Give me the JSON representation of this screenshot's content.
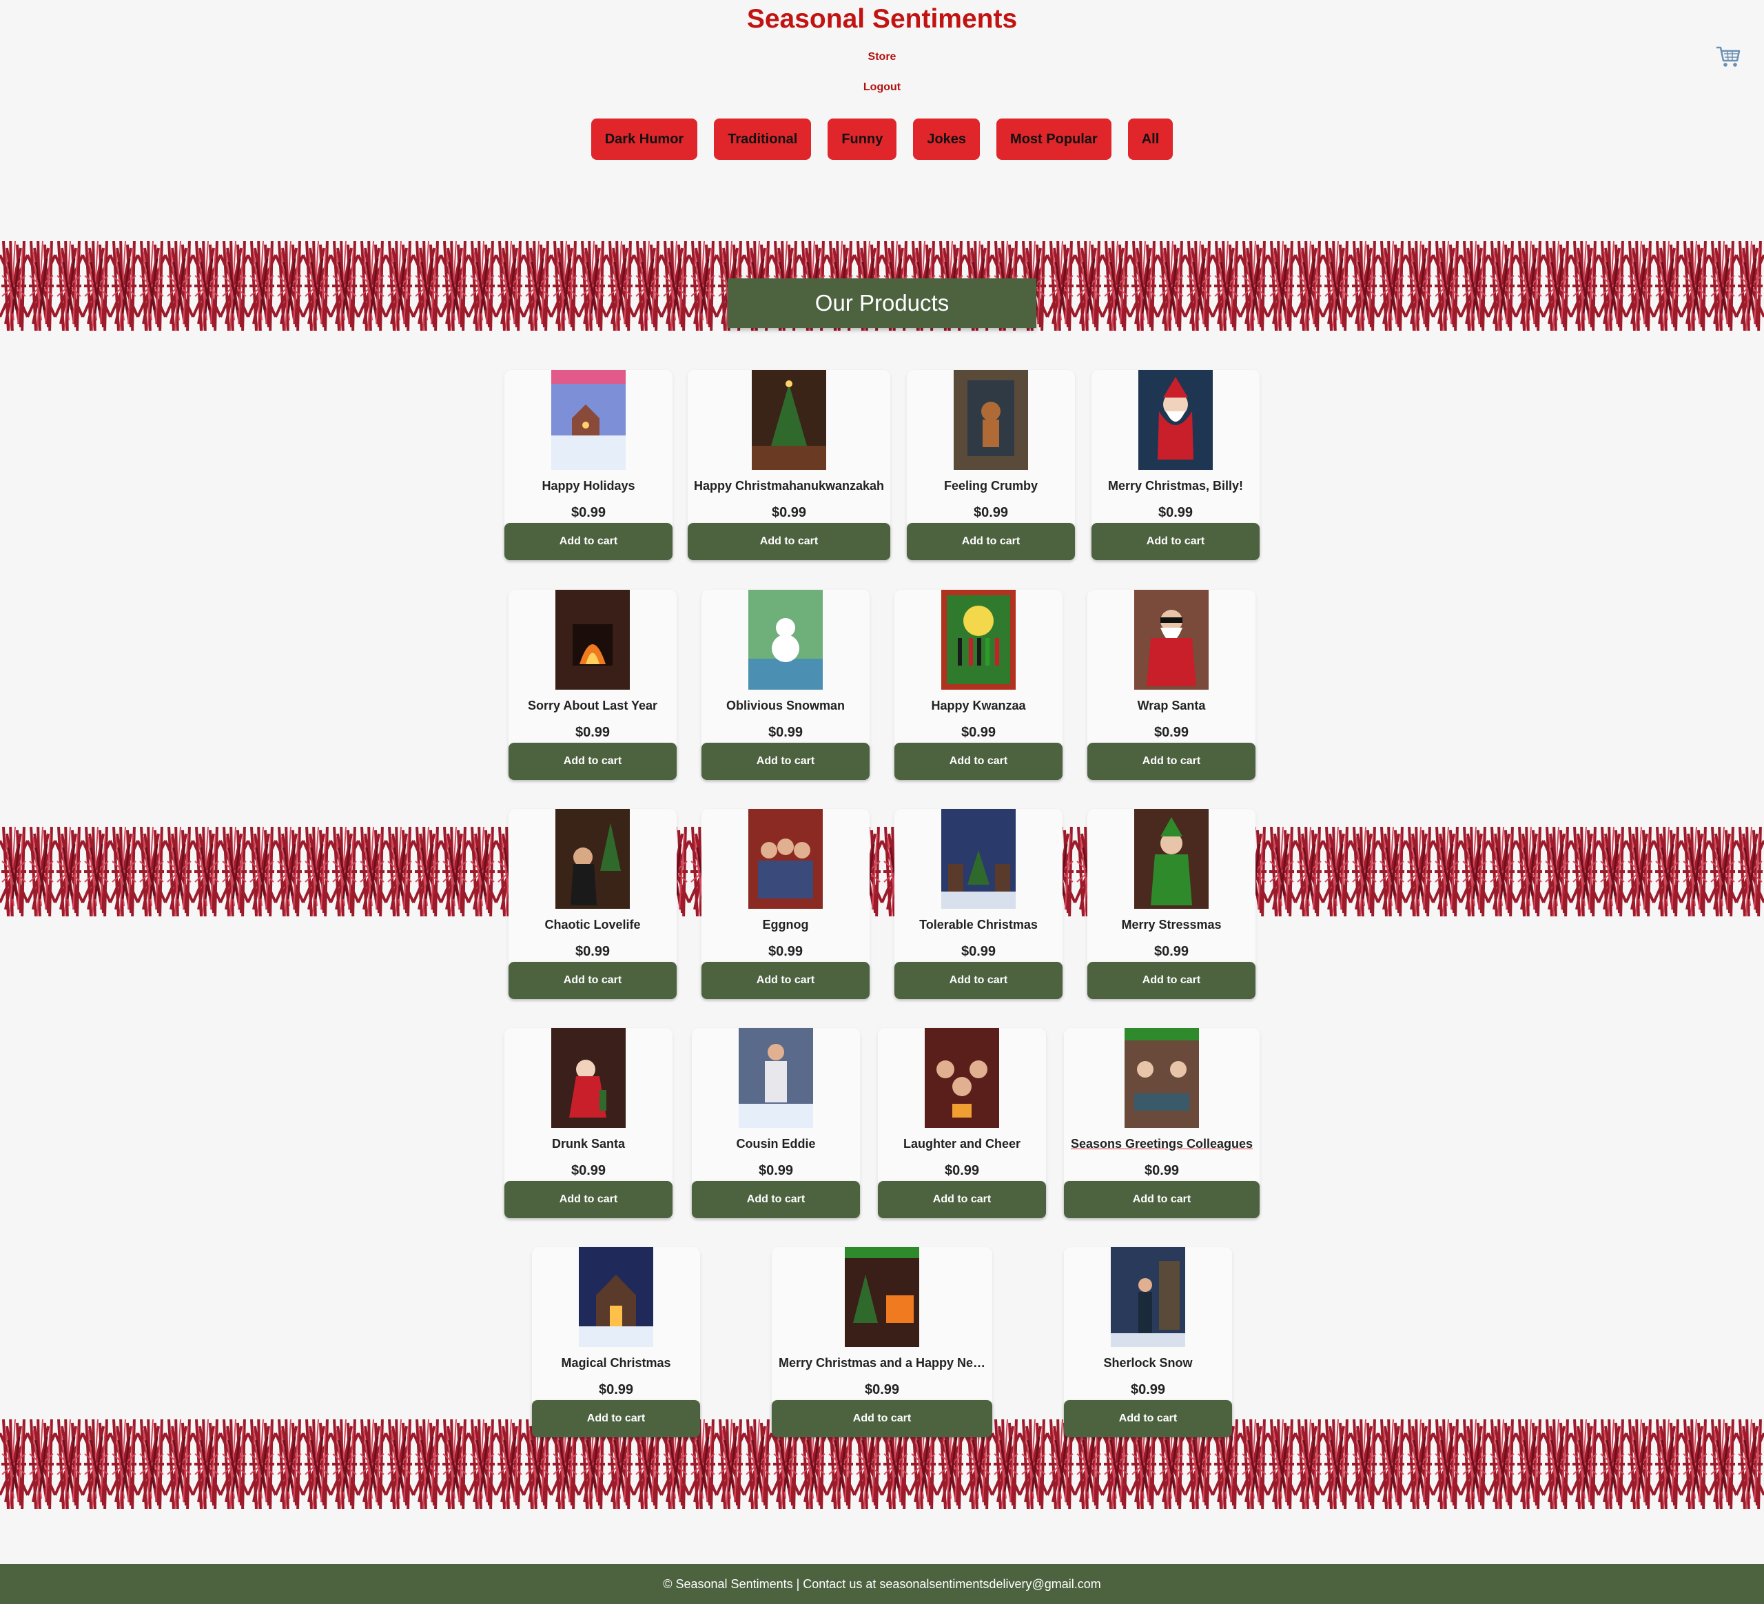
{
  "header": {
    "title": "Seasonal Sentiments",
    "nav": {
      "store": "Store",
      "logout": "Logout"
    },
    "cart_icon": "shopping-cart-icon",
    "categories": [
      "Dark Humor",
      "Traditional",
      "Funny",
      "Jokes",
      "Most Popular",
      "All"
    ]
  },
  "main": {
    "heading": "Our Products",
    "rows": [
      [
        {
          "name": "Happy Holidays",
          "price": "$0.99",
          "button": "Add to cart"
        },
        {
          "name": "Happy Christmahanukwanzakah",
          "price": "$0.99",
          "button": "Add to cart"
        },
        {
          "name": "Feeling Crumby",
          "price": "$0.99",
          "button": "Add to cart"
        },
        {
          "name": "Merry Christmas, Billy!",
          "price": "$0.99",
          "button": "Add to cart"
        }
      ],
      [
        {
          "name": "Sorry About Last Year",
          "price": "$0.99",
          "button": "Add to cart"
        },
        {
          "name": "Oblivious Snowman",
          "price": "$0.99",
          "button": "Add to cart"
        },
        {
          "name": "Happy Kwanzaa",
          "price": "$0.99",
          "button": "Add to cart"
        },
        {
          "name": "Wrap Santa",
          "price": "$0.99",
          "button": "Add to cart"
        }
      ],
      [
        {
          "name": "Chaotic Lovelife",
          "price": "$0.99",
          "button": "Add to cart"
        },
        {
          "name": "Eggnog",
          "price": "$0.99",
          "button": "Add to cart"
        },
        {
          "name": "Tolerable Christmas",
          "price": "$0.99",
          "button": "Add to cart"
        },
        {
          "name": "Merry Stressmas",
          "price": "$0.99",
          "button": "Add to cart"
        }
      ],
      [
        {
          "name": "Drunk Santa",
          "price": "$0.99",
          "button": "Add to cart"
        },
        {
          "name": "Cousin Eddie",
          "price": "$0.99",
          "button": "Add to cart"
        },
        {
          "name": "Laughter and Cheer",
          "price": "$0.99",
          "button": "Add to cart"
        },
        {
          "name": "Seasons Greetings Colleagues",
          "price": "$0.99",
          "button": "Add to cart"
        }
      ],
      [
        {
          "name": "Magical Christmas",
          "price": "$0.99",
          "button": "Add to cart"
        },
        {
          "name": "Merry Christmas and a Happy Ne…",
          "price": "$0.99",
          "button": "Add to cart"
        },
        {
          "name": "Sherlock Snow",
          "price": "$0.99",
          "button": "Add to cart"
        }
      ]
    ]
  },
  "footer": {
    "text": "© Seasonal Sentiments | Contact us at seasonalsentimentsdelivery@gmail.com"
  }
}
